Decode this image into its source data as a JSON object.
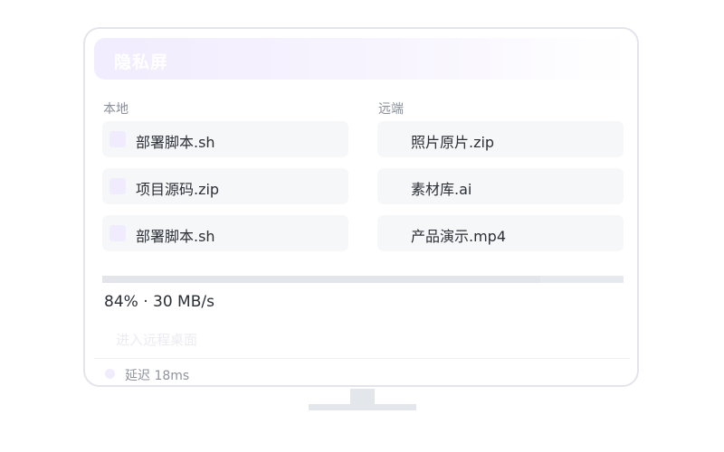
{
  "window": {
    "title": "隐私屏"
  },
  "local": {
    "label": "本地",
    "files": [
      {
        "name": "部署脚本.sh"
      },
      {
        "name": "项目源码.zip"
      },
      {
        "name": "部署脚本.sh"
      }
    ]
  },
  "remote": {
    "label": "远端",
    "files": [
      {
        "name": "照片原片.zip"
      },
      {
        "name": "素材库.ai"
      },
      {
        "name": "产品演示.mp4"
      }
    ]
  },
  "transfer": {
    "progress_percent": 84,
    "progress_text": "84% · 30 MB/s"
  },
  "actions": {
    "enter_remote_label": "进入远程桌面"
  },
  "status": {
    "latency_text": "延迟 18ms"
  },
  "colors": {
    "accent": "#f1ecfe",
    "text": "#2b2f36",
    "muted": "#8a8f99",
    "row_bg": "#f6f7f9"
  },
  "icons": {
    "status": "status-dot-icon",
    "file_select": "file-checkbox-icon"
  }
}
